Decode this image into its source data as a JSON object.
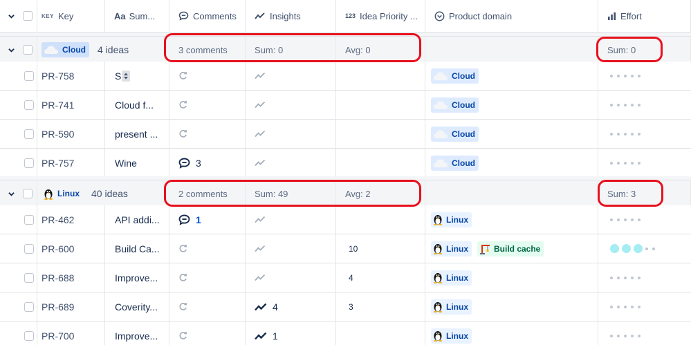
{
  "columns": {
    "key_small": "KEY",
    "key": "Key",
    "summary": "Sum...",
    "comments": "Comments",
    "insights": "Insights",
    "priority": "Idea Priority ...",
    "priority_type": "123",
    "domain": "Product domain",
    "effort": "Effort"
  },
  "groups": [
    {
      "name": "Cloud",
      "count": "4 ideas",
      "comments": "3 comments",
      "insights": "Sum: 0",
      "priority": "Avg: 0",
      "effort": "Sum: 0",
      "rows": [
        {
          "key": "PR-758",
          "summary": "S",
          "comments": "",
          "insights": "",
          "priority": "",
          "domain": "Cloud",
          "domain2": "",
          "effort": 0
        },
        {
          "key": "PR-741",
          "summary": "Cloud f...",
          "comments": "",
          "insights": "",
          "priority": "",
          "domain": "Cloud",
          "domain2": "",
          "effort": 0
        },
        {
          "key": "PR-590",
          "summary": "present ...",
          "comments": "",
          "insights": "",
          "priority": "",
          "domain": "Cloud",
          "domain2": "",
          "effort": 0
        },
        {
          "key": "PR-757",
          "summary": "Wine",
          "comments": "3",
          "insights": "",
          "priority": "",
          "domain": "Cloud",
          "domain2": "",
          "effort": 0
        }
      ]
    },
    {
      "name": "Linux",
      "count": "40 ideas",
      "comments": "2 comments",
      "insights": "Sum: 49",
      "priority": "Avg: 2",
      "effort": "Sum: 3",
      "rows": [
        {
          "key": "PR-462",
          "summary": "API addi...",
          "comments": "1",
          "insights": "",
          "priority": "",
          "domain": "Linux",
          "domain2": "",
          "effort": 0
        },
        {
          "key": "PR-600",
          "summary": "Build Ca...",
          "comments": "",
          "insights": "",
          "priority": "10",
          "domain": "Linux",
          "domain2": "Build cache",
          "effort": 3
        },
        {
          "key": "PR-688",
          "summary": "Improve...",
          "comments": "",
          "insights": "",
          "priority": "4",
          "domain": "Linux",
          "domain2": "",
          "effort": 0
        },
        {
          "key": "PR-689",
          "summary": "Coverity...",
          "comments": "",
          "insights": "4",
          "priority": "3",
          "domain": "Linux",
          "domain2": "",
          "effort": 0
        },
        {
          "key": "PR-700",
          "summary": "Improve...",
          "comments": "",
          "insights": "1",
          "priority": "",
          "domain": "Linux",
          "domain2": "",
          "effort": 0
        }
      ]
    }
  ],
  "colors": {
    "annotation": "#e8101d",
    "tag_bg": "#deebff",
    "tag_text": "#0747a6",
    "effort_fill": "#a5ecf3"
  },
  "effort_max": 5
}
